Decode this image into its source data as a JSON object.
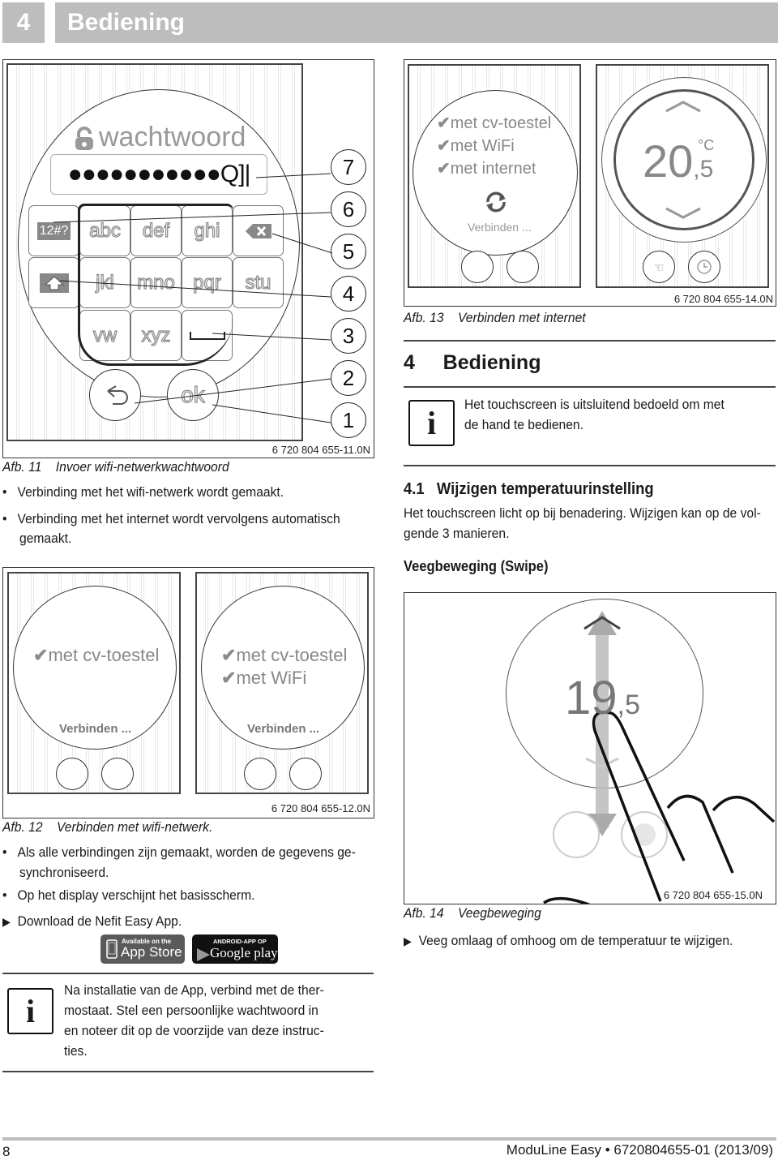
{
  "header": {
    "chapter_number": "4",
    "chapter_title": "Bediening"
  },
  "fig11": {
    "screen_title": "wachtwoord",
    "password_field_value": "●●●●●●●●●●●Q]|",
    "keys": {
      "special": "12#?",
      "row1": [
        "abc",
        "def",
        "ghi"
      ],
      "row2": [
        "jkl",
        "mno",
        "pqr",
        "stu"
      ],
      "row3": [
        "vw",
        "xyz"
      ],
      "backspace_icon": "backspace-icon",
      "shift_icon": "shift-up-arrow-icon",
      "space_icon": "space-bar-icon"
    },
    "ok_label": "ok",
    "callouts": [
      "7",
      "6",
      "5",
      "4",
      "3",
      "2",
      "1"
    ],
    "code": "6 720 804 655-11.0N",
    "caption_label": "Afb. 11",
    "caption_text": "Invoer wifi-netwerkwachtwoord"
  },
  "left_bullets_1": [
    "Verbinding met het wifi-netwerk wordt gemaakt.",
    "Verbinding met het internet wordt vervolgens automatisch",
    "gemaakt."
  ],
  "fig12": {
    "screen1": {
      "checks": [
        "met cv-toestel"
      ],
      "status": "Verbinden ..."
    },
    "screen2": {
      "checks": [
        "met cv-toestel",
        "met WiFi"
      ],
      "status": "Verbinden ..."
    },
    "code": "6 720 804 655-12.0N",
    "caption_label": "Afb. 12",
    "caption_text": "Verbinden met wifi-netwerk."
  },
  "left_bullets_2": [
    "Als alle verbindingen zijn gemaakt, worden de gegevens ge-",
    "synchroniseerd.",
    "Op het display verschijnt het basisscherm."
  ],
  "download_step": "Download de Nefit Easy App.",
  "badges": {
    "appstore_small": "Available on the",
    "appstore_big": "App Store",
    "google_small": "ANDROID-APP OP",
    "google_big": "Google play"
  },
  "info_note_2": [
    "Na installatie van de App, verbind met de ther-",
    "mostaat. Stel een persoonlijke wachtwoord in",
    "en noteer dit op de voorzijde van deze instruc-",
    "ties."
  ],
  "fig13": {
    "screen1": {
      "checks": [
        "met cv-toestel",
        "met WiFi",
        "met internet"
      ],
      "status": "Verbinden ..."
    },
    "screen2": {
      "temp_int": "20",
      "temp_dec": ",5",
      "unit": "°C"
    },
    "code": "6 720 804 655-14.0N",
    "caption_label": "Afb. 13",
    "caption_text": "Verbinden met internet"
  },
  "section4": {
    "number": "4",
    "title": "Bediening"
  },
  "info_note_1": [
    "Het touchscreen is uitsluitend bedoeld om met",
    "de hand te bedienen."
  ],
  "section41": {
    "number": "4.1",
    "title": "Wijzigen temperatuurinstelling",
    "body": [
      "Het touchscreen licht op bij benadering. Wijzigen kan op de vol-",
      "gende 3 manieren."
    ],
    "subheading": "Veegbeweging (Swipe)"
  },
  "fig14": {
    "temp_int": "19",
    "temp_dec": ",5",
    "code": "6 720 804 655-15.0N",
    "caption_label": "Afb. 14",
    "caption_text": "Veegbeweging"
  },
  "swipe_step": "Veeg omlaag of omhoog om de temperatuur te wijzigen.",
  "footer": {
    "page_number": "8",
    "doc_ref": "ModuLine Easy • 6720804655-01 (2013/09)"
  }
}
